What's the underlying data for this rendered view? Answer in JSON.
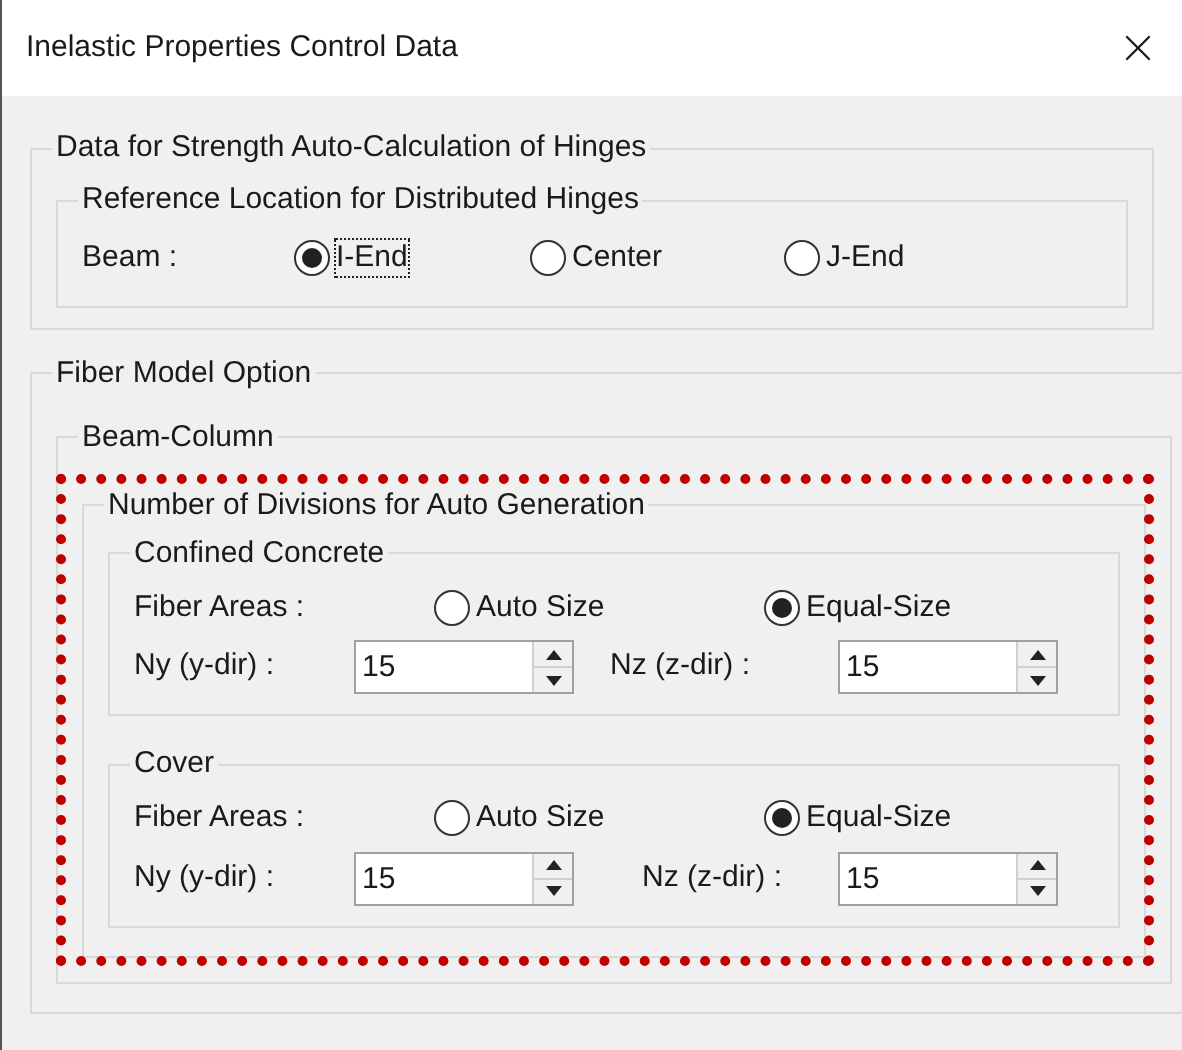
{
  "window": {
    "title": "Inelastic Properties Control Data"
  },
  "hinge_group": {
    "title": "Data for Strength Auto-Calculation of Hinges",
    "subgroup": {
      "title": "Reference Location for Distributed Hinges",
      "label": "Beam :",
      "options": [
        {
          "label": "I-End",
          "selected": true,
          "focused": true
        },
        {
          "label": "Center",
          "selected": false,
          "focused": false
        },
        {
          "label": "J-End",
          "selected": false,
          "focused": false
        }
      ]
    }
  },
  "fiber_group": {
    "title": "Fiber Model Option",
    "beam_column": {
      "title": "Beam-Column",
      "divisions": {
        "title": "Number of Divisions for Auto Generation",
        "highlighted": true,
        "sections": [
          {
            "title": "Confined Concrete",
            "fiber_label": "Fiber Areas :",
            "options": [
              {
                "label": "Auto Size",
                "selected": false
              },
              {
                "label": "Equal-Size",
                "selected": true
              }
            ],
            "ny_label": "Ny (y-dir) :",
            "ny_value": "15",
            "nz_label": "Nz (z-dir) :",
            "nz_value": "15"
          },
          {
            "title": "Cover",
            "fiber_label": "Fiber Areas :",
            "options": [
              {
                "label": "Auto Size",
                "selected": false
              },
              {
                "label": "Equal-Size",
                "selected": true
              }
            ],
            "ny_label": "Ny (y-dir) :",
            "ny_value": "15",
            "nz_label": "Nz (z-dir) :",
            "nz_value": "15"
          }
        ]
      }
    }
  }
}
